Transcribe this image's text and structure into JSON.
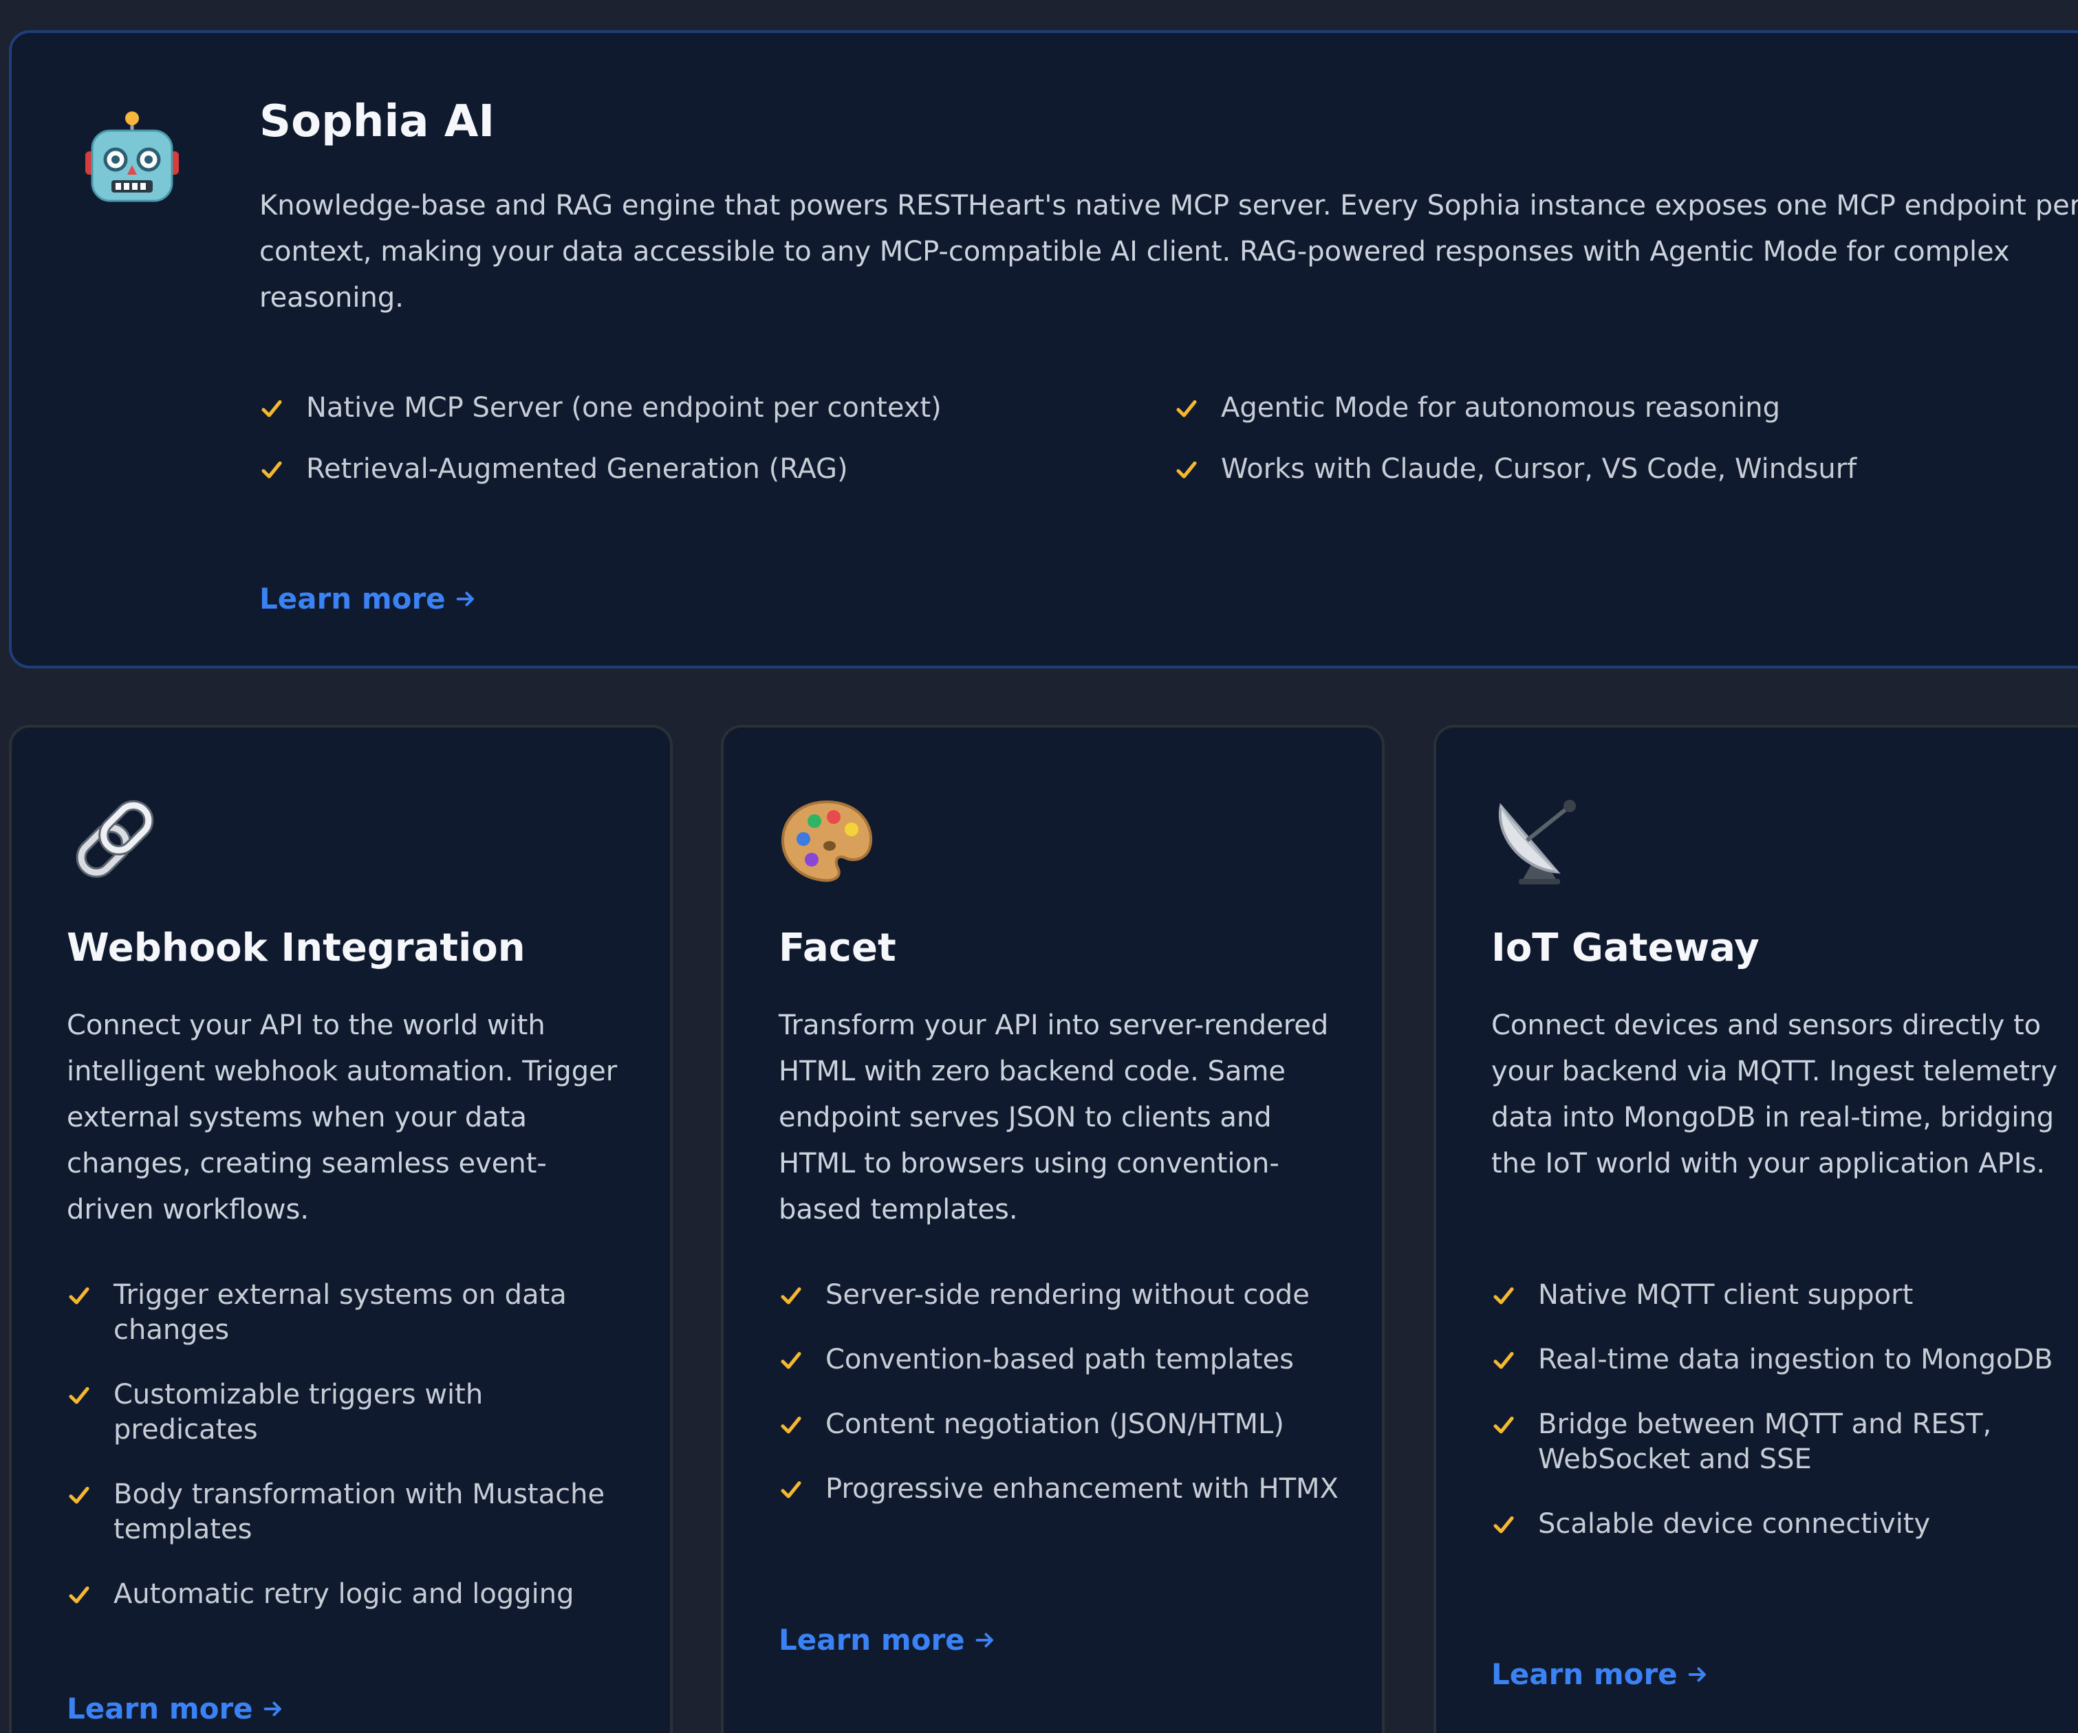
{
  "featured": {
    "icon": "robot-icon",
    "title": "Sophia AI",
    "description": "Knowledge-base and RAG engine that powers RESTHeart's native MCP server. Every Sophia instance exposes one MCP endpoint per context, making your data accessible to any MCP-compatible AI client. RAG-powered responses with Agentic Mode for complex reasoning.",
    "features": [
      "Native MCP Server (one endpoint per context)",
      "Agentic Mode for autonomous reasoning",
      "Retrieval-Augmented Generation (RAG)",
      "Works with Claude, Cursor, VS Code, Windsurf"
    ],
    "link_label": "Learn more"
  },
  "cards": [
    {
      "icon": "link-icon",
      "title": "Webhook Integration",
      "description": "Connect your API to the world with intelligent webhook automation. Trigger external systems when your data changes, creating seamless event-driven workflows.",
      "features": [
        "Trigger external systems on data changes",
        "Customizable triggers with predicates",
        "Body transformation with Mustache templates",
        "Automatic retry logic and logging"
      ],
      "link_label": "Learn more"
    },
    {
      "icon": "palette-icon",
      "title": "Facet",
      "description": "Transform your API into server-rendered HTML with zero backend code. Same endpoint serves JSON to clients and HTML to browsers using convention-based templates.",
      "features": [
        "Server-side rendering without code",
        "Convention-based path templates",
        "Content negotiation (JSON/HTML)",
        "Progressive enhancement with HTMX"
      ],
      "link_label": "Learn more"
    },
    {
      "icon": "satellite-dish-icon",
      "title": "IoT Gateway",
      "description": "Connect devices and sensors directly to your backend via MQTT. Ingest telemetry data into MongoDB in real-time, bridging the IoT world with your application APIs.",
      "features": [
        "Native MQTT client support",
        "Real-time data ingestion to MongoDB",
        "Bridge between MQTT and REST, WebSocket and SSE",
        "Scalable device connectivity"
      ],
      "link_label": "Learn more"
    }
  ],
  "colors": {
    "page_background": "#1c2230",
    "card_background": "#0f1a2e",
    "featured_border": "#1e3f7a",
    "card_border": "#2b2f36",
    "accent_link": "#3b82f6",
    "check": "#f5b82e"
  }
}
